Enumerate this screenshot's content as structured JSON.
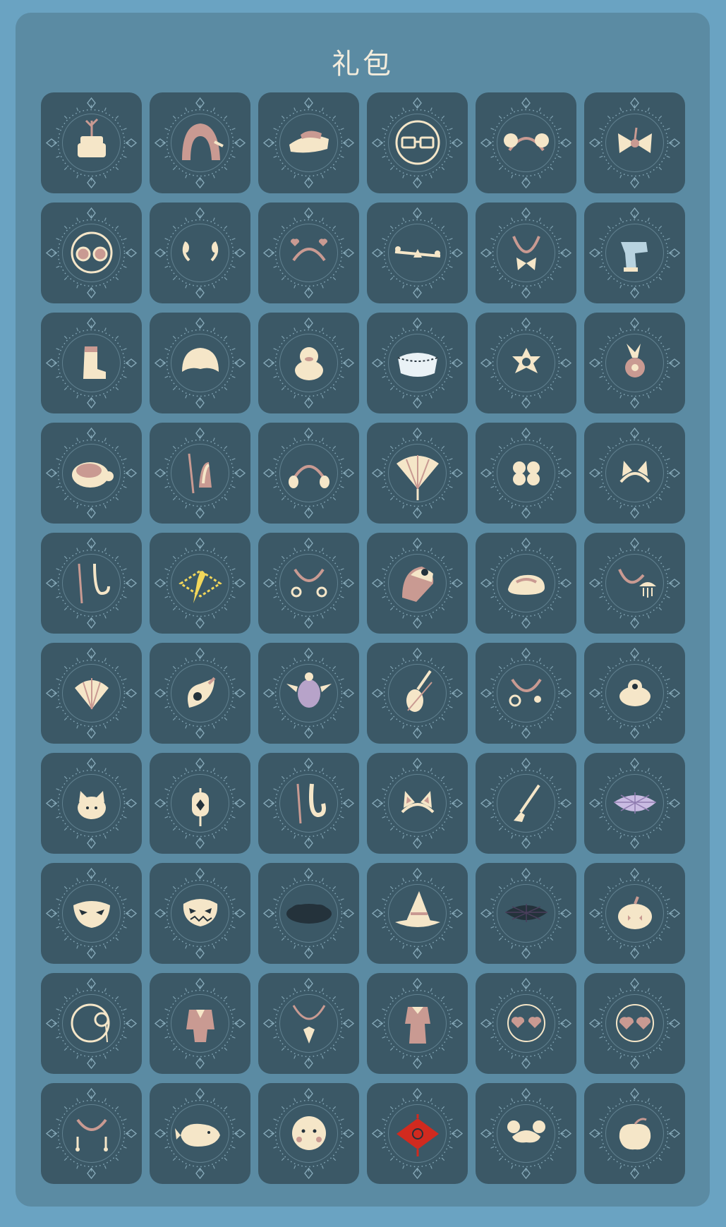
{
  "page": {
    "title": "礼包"
  },
  "colors": {
    "background": "#6aa3c2",
    "panel": "#5b8ba3",
    "tile": "#3b5866",
    "ornament": "#8fb2c2",
    "cream": "#f5e6c8",
    "pink": "#c99a92",
    "dark": "#24323b",
    "accent_red": "#d12a1f",
    "accent_yellow": "#f2d75a"
  },
  "items": [
    {
      "icon": "potted-plant-icon",
      "shape": "pot"
    },
    {
      "icon": "hood-icon",
      "shape": "hood"
    },
    {
      "icon": "cap-icon",
      "shape": "cap"
    },
    {
      "icon": "glasses-icon",
      "shape": "glasses"
    },
    {
      "icon": "hair-buns-icon",
      "shape": "buns"
    },
    {
      "icon": "bow-icon",
      "shape": "bow"
    },
    {
      "icon": "round-glasses-icon",
      "shape": "roundglasses"
    },
    {
      "icon": "laurel-icon",
      "shape": "laurel"
    },
    {
      "icon": "heart-headband-icon",
      "shape": "heartband"
    },
    {
      "icon": "seesaw-icon",
      "shape": "seesaw"
    },
    {
      "icon": "bow-necklace-icon",
      "shape": "bownecklace"
    },
    {
      "icon": "scarf-icon",
      "shape": "scarf"
    },
    {
      "icon": "boot-icon",
      "shape": "boot"
    },
    {
      "icon": "hair-icon",
      "shape": "hair"
    },
    {
      "icon": "duck-hat-icon",
      "shape": "duck"
    },
    {
      "icon": "cape-icon",
      "shape": "cape"
    },
    {
      "icon": "star-flower-icon",
      "shape": "star"
    },
    {
      "icon": "flower-hairpin-icon",
      "shape": "flowerpin"
    },
    {
      "icon": "turtle-icon",
      "shape": "turtle"
    },
    {
      "icon": "horn-necklace-icon",
      "shape": "hornnecklace"
    },
    {
      "icon": "earmuff-icon",
      "shape": "earmuff"
    },
    {
      "icon": "fan-icon",
      "shape": "fan"
    },
    {
      "icon": "clover-icon",
      "shape": "clover"
    },
    {
      "icon": "fox-ears-icon",
      "shape": "foxears"
    },
    {
      "icon": "hook-necklace-icon",
      "shape": "hook"
    },
    {
      "icon": "yellow-pendant-icon",
      "shape": "yellowpendant"
    },
    {
      "icon": "sun-earrings-icon",
      "shape": "sunearrings"
    },
    {
      "icon": "sun-hat-icon",
      "shape": "sunhat"
    },
    {
      "icon": "sandal-icon",
      "shape": "sandal"
    },
    {
      "icon": "jellyfish-necklace-icon",
      "shape": "jellyfish"
    },
    {
      "icon": "shell-icon",
      "shape": "shell"
    },
    {
      "icon": "conch-icon",
      "shape": "conch"
    },
    {
      "icon": "sea-turtle-icon",
      "shape": "seaturtle"
    },
    {
      "icon": "violin-icon",
      "shape": "violin"
    },
    {
      "icon": "hoop-earrings-icon",
      "shape": "hoops"
    },
    {
      "icon": "pet-icon",
      "shape": "pet"
    },
    {
      "icon": "cat-icon",
      "shape": "cat"
    },
    {
      "icon": "lantern-icon",
      "shape": "lantern"
    },
    {
      "icon": "tooth-necklace-icon",
      "shape": "tooth"
    },
    {
      "icon": "cat-ears-icon",
      "shape": "catears"
    },
    {
      "icon": "broom-icon",
      "shape": "broom"
    },
    {
      "icon": "spider-web-icon",
      "shape": "web"
    },
    {
      "icon": "mask-icon",
      "shape": "mask"
    },
    {
      "icon": "pumpkin-mask-icon",
      "shape": "pumpkinmask"
    },
    {
      "icon": "dark-cloud-icon",
      "shape": "darkcloud"
    },
    {
      "icon": "witch-hat-icon",
      "shape": "witchhat"
    },
    {
      "icon": "dark-web-icon",
      "shape": "darkweb"
    },
    {
      "icon": "pumpkin-icon",
      "shape": "pumpkin"
    },
    {
      "icon": "monocle-icon",
      "shape": "monocle"
    },
    {
      "icon": "suit-icon",
      "shape": "suit"
    },
    {
      "icon": "tie-necklace-icon",
      "shape": "tie"
    },
    {
      "icon": "outfit-icon",
      "shape": "outfit"
    },
    {
      "icon": "heart-glasses-icon",
      "shape": "heartglasses"
    },
    {
      "icon": "heart-sunglasses-icon",
      "shape": "heartsunglasses"
    },
    {
      "icon": "bead-earrings-icon",
      "shape": "beads"
    },
    {
      "icon": "whale-icon",
      "shape": "whale"
    },
    {
      "icon": "face-mask-icon",
      "shape": "face"
    },
    {
      "icon": "red-lantern-icon",
      "shape": "redlantern"
    },
    {
      "icon": "double-buns-icon",
      "shape": "doublebuns"
    },
    {
      "icon": "peach-icon",
      "shape": "peach"
    }
  ]
}
